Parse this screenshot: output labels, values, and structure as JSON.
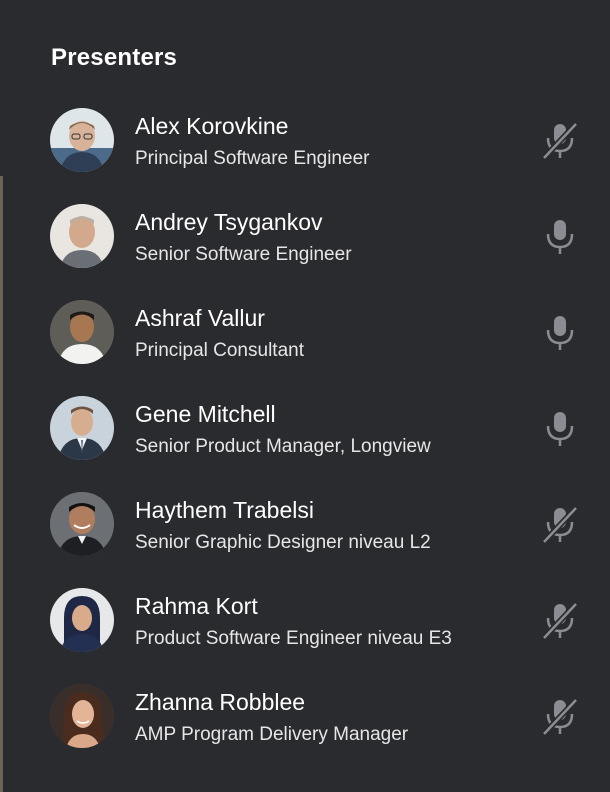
{
  "panel": {
    "title": "Presenters"
  },
  "colors": {
    "background": "#2a2b2f",
    "text_primary": "#ffffff",
    "text_secondary": "#e6e6e6",
    "icon": "#8a8d93"
  },
  "presenters": [
    {
      "name": "Alex Korovkine",
      "role": "Principal Software Engineer",
      "mic": "mic-muted-icon",
      "muted": true
    },
    {
      "name": "Andrey Tsygankov",
      "role": "Senior Software Engineer",
      "mic": "mic-icon",
      "muted": false
    },
    {
      "name": "Ashraf Vallur",
      "role": "Principal Consultant",
      "mic": "mic-icon",
      "muted": false
    },
    {
      "name": "Gene Mitchell",
      "role": "Senior Product Manager, Longview",
      "mic": "mic-icon",
      "muted": false
    },
    {
      "name": "Haythem Trabelsi",
      "role": "Senior Graphic Designer niveau L2",
      "mic": "mic-muted-icon",
      "muted": true
    },
    {
      "name": "Rahma Kort",
      "role": "Product Software Engineer niveau E3",
      "mic": "mic-muted-icon",
      "muted": true
    },
    {
      "name": "Zhanna Robblee",
      "role": "AMP Program Delivery Manager",
      "mic": "mic-muted-icon",
      "muted": true
    }
  ]
}
